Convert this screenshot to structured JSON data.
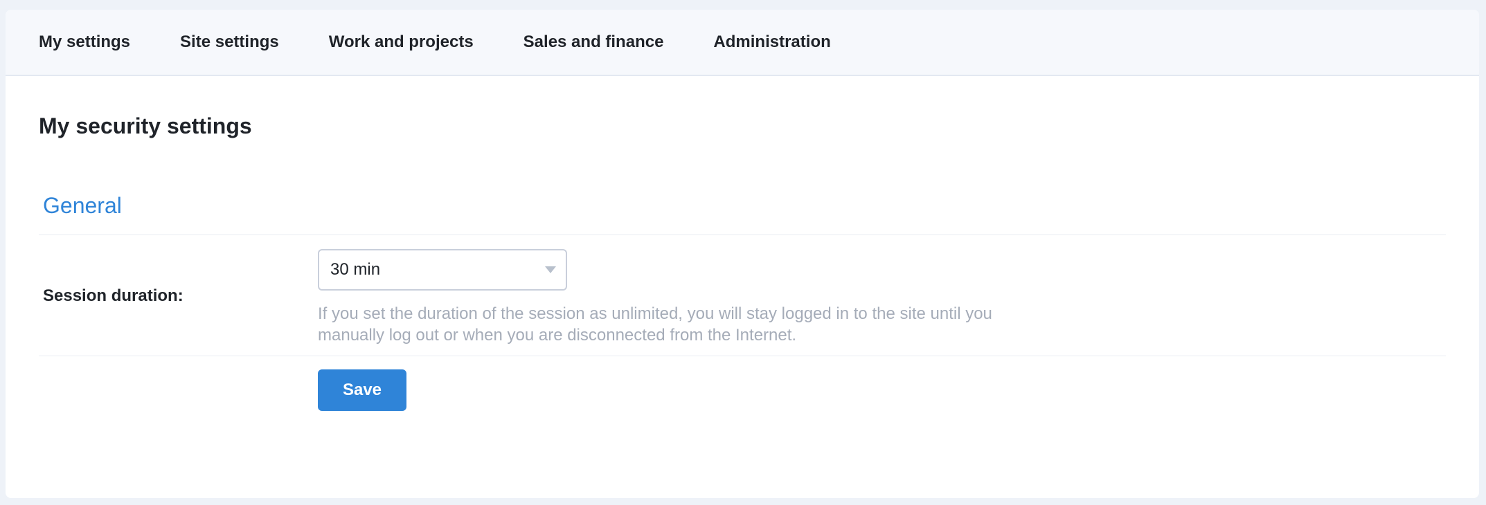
{
  "nav": {
    "items": [
      {
        "label": "My settings"
      },
      {
        "label": "Site settings"
      },
      {
        "label": "Work and projects"
      },
      {
        "label": "Sales and finance"
      },
      {
        "label": "Administration"
      }
    ]
  },
  "page": {
    "title": "My security settings"
  },
  "section": {
    "title": "General"
  },
  "session": {
    "label": "Session duration:",
    "selected_value": "30 min",
    "hint": "If you set the duration of the session as unlimited, you will stay logged in to the site until you manually log out or when you are disconnected from the Internet."
  },
  "actions": {
    "save_label": "Save"
  },
  "colors": {
    "accent": "#2f84d8",
    "nav_background": "#f6f8fc",
    "page_background": "#eef2f8",
    "hint_text": "#a5acb8"
  },
  "icons": {
    "select_caret": "chevron-down-icon"
  }
}
